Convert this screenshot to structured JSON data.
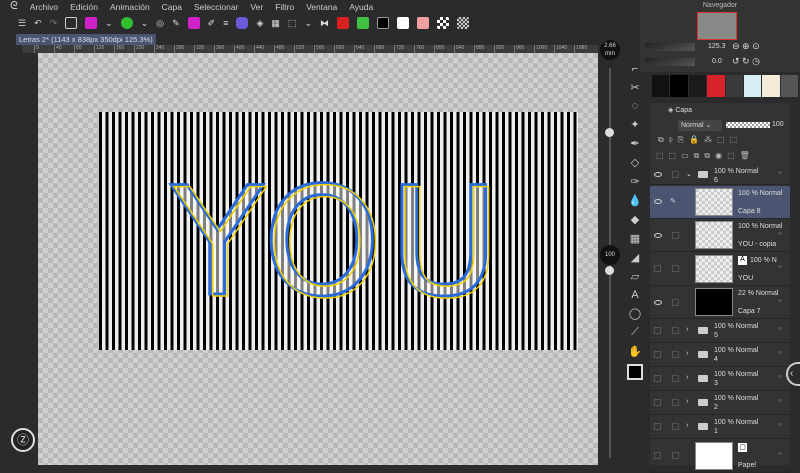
{
  "menu": [
    "Archivo",
    "Edición",
    "Animación",
    "Capa",
    "Seleccionar",
    "Ver",
    "Filtro",
    "Ventana",
    "Ayuda"
  ],
  "document_tab": "Letras 2* (1143 x 838px 350dpi 125.3%)",
  "ruler_ticks": [
    "0",
    "40",
    "80",
    "120",
    "160",
    "200",
    "240",
    "280",
    "320",
    "360",
    "400",
    "440",
    "480",
    "520",
    "560",
    "600",
    "640",
    "680",
    "720",
    "760",
    "800",
    "840",
    "880",
    "920",
    "960",
    "1000",
    "1040",
    "1080"
  ],
  "brush_size": "2.66",
  "brush_unit": "mm",
  "opacity_readout": "100",
  "navigator": {
    "title": "Navegador",
    "zoom": "125.3",
    "rotation": "0.0"
  },
  "canvas_text": "YOU",
  "swatch_colors": [
    "#111111",
    "#000000",
    "#1a1a1a",
    "#d8232a",
    "#3a3a3a",
    "#d8eef5",
    "#f3ead8",
    "#555555"
  ],
  "layer_panel": {
    "tab": "Capa",
    "blend_mode": "Normal",
    "opacity": "100",
    "layers": [
      {
        "info": "100 % Normal",
        "name": "6",
        "type": "folder",
        "visible": true
      },
      {
        "info": "100 % Normal",
        "name": "Capa 8",
        "type": "layer",
        "visible": true,
        "selected": true
      },
      {
        "info": "100 % Normal",
        "name": "YOU - copia",
        "type": "layer",
        "visible": true
      },
      {
        "info": "100 % N",
        "name": "YOU",
        "type": "text",
        "visible": false
      },
      {
        "info": "22 % Normal",
        "name": "Capa 7",
        "type": "layer",
        "visible": true
      },
      {
        "info": "100 % Normal",
        "name": "5",
        "type": "folder"
      },
      {
        "info": "100 % Normal",
        "name": "4",
        "type": "folder"
      },
      {
        "info": "100 % Normal",
        "name": "3",
        "type": "folder"
      },
      {
        "info": "100 % Normal",
        "name": "2",
        "type": "folder"
      },
      {
        "info": "100 % Normal",
        "name": "1",
        "type": "folder"
      },
      {
        "info": "",
        "name": "Papel",
        "type": "paper"
      }
    ]
  }
}
